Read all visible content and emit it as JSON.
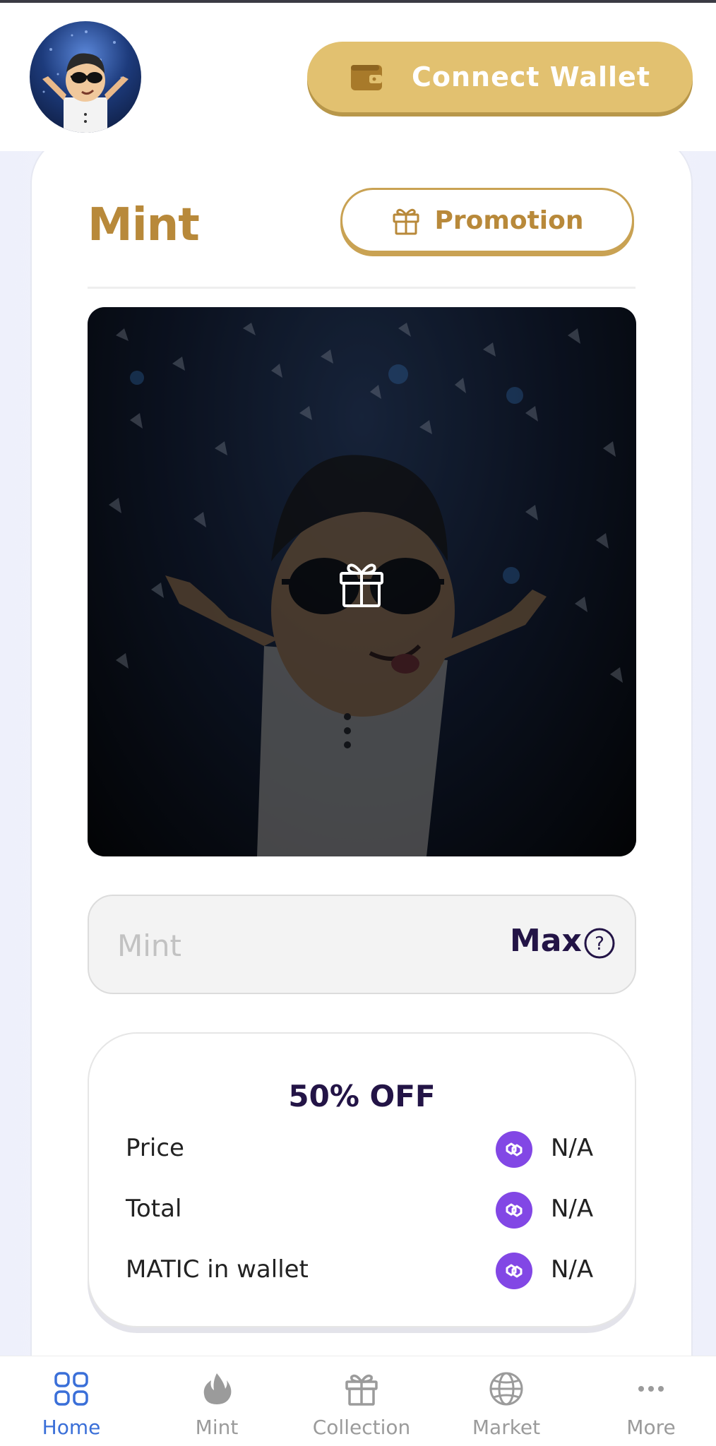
{
  "header": {
    "connect_wallet_label": "Connect Wallet"
  },
  "mint_card": {
    "title": "Mint",
    "promotion_label": "Promotion",
    "input_placeholder": "Mint",
    "max_label": "Max",
    "discount": "50% OFF",
    "rows": [
      {
        "label": "Price",
        "value": "N/A",
        "icon": "polygon-coin-icon"
      },
      {
        "label": "Total",
        "value": "N/A",
        "icon": "polygon-coin-icon"
      },
      {
        "label": "MATIC in wallet",
        "value": "N/A",
        "icon": "polygon-coin-icon"
      }
    ]
  },
  "bottom_nav": {
    "items": [
      {
        "label": "Home",
        "icon": "grid-icon",
        "active": true
      },
      {
        "label": "Mint",
        "icon": "flame-icon",
        "active": false
      },
      {
        "label": "Collection",
        "icon": "gift-icon",
        "active": false
      },
      {
        "label": "Market",
        "icon": "globe-icon",
        "active": false
      },
      {
        "label": "More",
        "icon": "dots-icon",
        "active": false
      }
    ]
  },
  "colors": {
    "gold": "#e2c170",
    "gold_text": "#b8893a",
    "dark_text": "#231446",
    "polygon_purple": "#8247e5",
    "nav_active": "#3a6fd8"
  }
}
